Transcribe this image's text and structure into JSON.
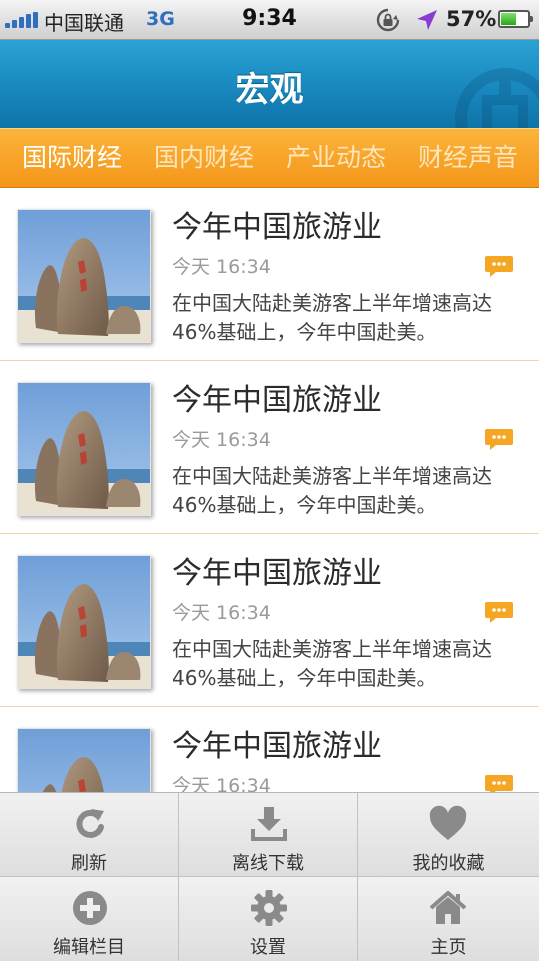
{
  "status_bar": {
    "carrier": "中国联通",
    "network": "3G",
    "time": "9:34",
    "battery_percent": "57%",
    "battery_level": 0.57
  },
  "header": {
    "title": "宏观"
  },
  "tabs": [
    {
      "label": "国际财经",
      "active": true
    },
    {
      "label": "国内财经",
      "active": false
    },
    {
      "label": "产业动态",
      "active": false
    },
    {
      "label": "财经声音",
      "active": false
    }
  ],
  "news": [
    {
      "title": "今年中国旅游业",
      "time": "今天 16:34",
      "summary": "在中国大陆赴美游客上半年增速高达46%基础上，今年中国赴美。"
    },
    {
      "title": "今年中国旅游业",
      "time": "今天 16:34",
      "summary": "在中国大陆赴美游客上半年增速高达46%基础上，今年中国赴美。"
    },
    {
      "title": "今年中国旅游业",
      "time": "今天 16:34",
      "summary": "在中国大陆赴美游客上半年增速高达46%基础上，今年中国赴美。"
    },
    {
      "title": "今年中国旅游业",
      "time": "今天 16:34",
      "summary": ""
    }
  ],
  "toolbar": {
    "refresh": "刷新",
    "offline_download": "离线下载",
    "favorites": "我的收藏",
    "edit_columns": "编辑栏目",
    "settings": "设置",
    "home": "主页"
  },
  "colors": {
    "header_blue": "#1888bf",
    "tab_orange": "#f4961a",
    "comment_badge": "#f5a623",
    "signal_blue": "#2f6fc0"
  }
}
